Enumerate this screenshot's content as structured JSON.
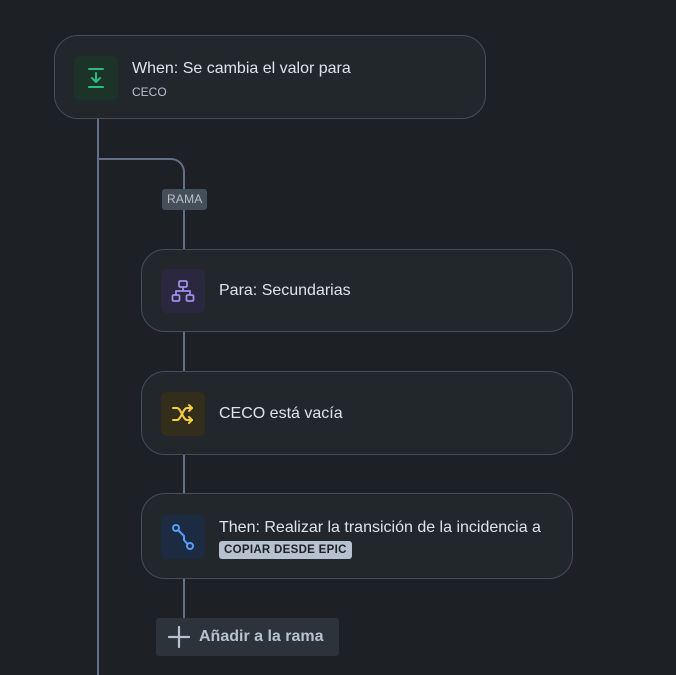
{
  "trigger": {
    "title": "When: Se cambia el valor para",
    "subtitle": "CECO",
    "icon": "download-arrow-icon",
    "accent": "#2abb7f"
  },
  "branch": {
    "badge": "RAMA",
    "steps": [
      {
        "title": "Para: Secundarias",
        "icon": "hierarchy-icon",
        "accent": "#9f8fef"
      },
      {
        "title": "CECO está vacía",
        "icon": "shuffle-icon",
        "accent": "#f5cd47"
      },
      {
        "title": "Then: Realizar la transición de la incidencia a",
        "lozenge": "COPIAR DESDE EPIC",
        "icon": "transition-icon",
        "accent": "#579dff"
      }
    ],
    "add_label": "Añadir a la rama"
  },
  "colors": {
    "background": "#1d2125",
    "card": "#22272b",
    "card_border": "#454f59",
    "connector": "#626f86"
  }
}
